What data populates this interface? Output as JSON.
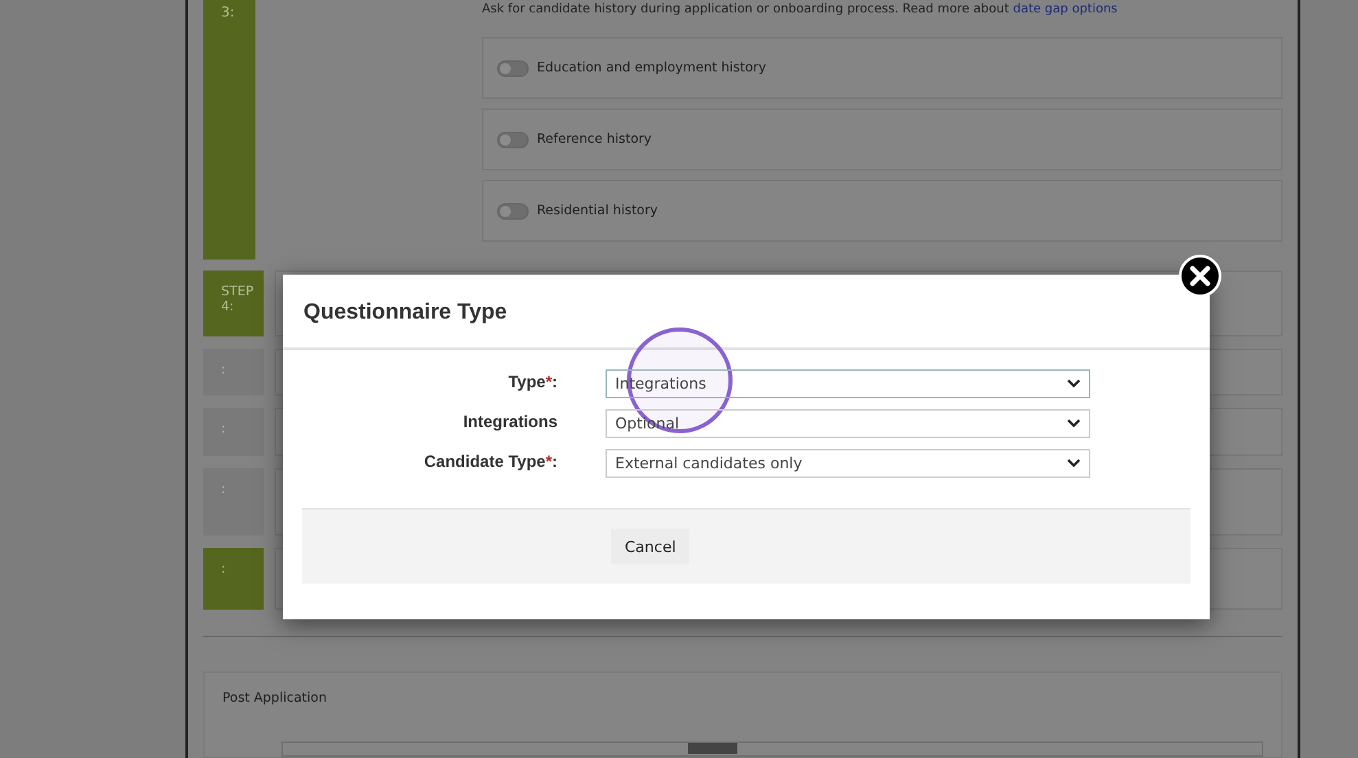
{
  "step_three": {
    "label": "3:",
    "description": "Ask for candidate history during application or onboarding process. Read more about",
    "link": "date gap options",
    "toggles": [
      {
        "label": "Education and employment history",
        "on": false
      },
      {
        "label": "Reference history",
        "on": false
      },
      {
        "label": "Residential history",
        "on": false
      }
    ]
  },
  "steps": [
    {
      "label": "STEP 4:",
      "color": "#55661e"
    },
    {
      "label": ":",
      "color": "#7a7a7a"
    },
    {
      "label": ":",
      "color": "#7a7a7a"
    },
    {
      "label": ":",
      "color": "#7a7a7a"
    },
    {
      "label": ":",
      "color": "#55661e"
    }
  ],
  "post_application": {
    "title": "Post Application"
  },
  "modal": {
    "title": "Questionnaire Type",
    "fields": [
      {
        "label": "Type",
        "mark": "*",
        "colon": ":",
        "value": "Integrations",
        "focused": true
      },
      {
        "label": "Integrations",
        "value": "Optional",
        "focused": false
      },
      {
        "label": "Candidate Type",
        "mark": "*",
        "colon": ":",
        "value": "External candidates only",
        "focused": false
      }
    ],
    "buttons": [
      "Cancel"
    ]
  }
}
